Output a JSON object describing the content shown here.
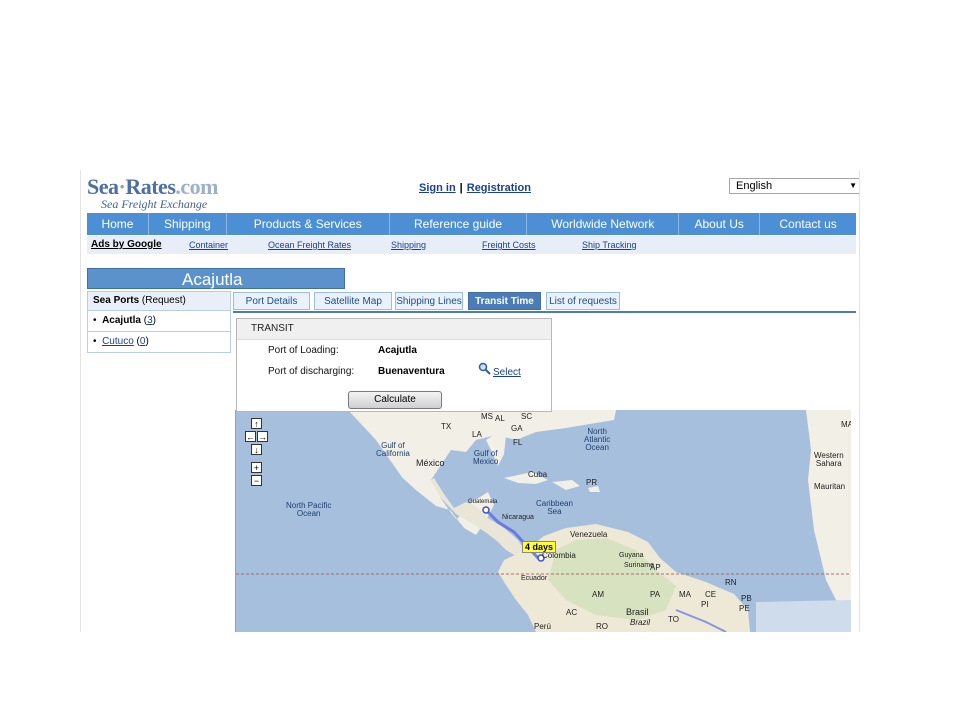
{
  "header": {
    "logo": {
      "sea": "Sea",
      "dot": "·",
      "rates": "Rates",
      "com": ".com",
      "tagline": "Sea Freight Exchange"
    },
    "sign_in": "Sign in",
    "separator": "|",
    "registration": "Registration",
    "language": "English"
  },
  "nav": {
    "items": [
      {
        "label": "Home"
      },
      {
        "label": "Shipping"
      },
      {
        "label": "Products & Services"
      },
      {
        "label": "Reference guide"
      },
      {
        "label": "Worldwide Network"
      },
      {
        "label": "About Us"
      },
      {
        "label": "Contact us"
      }
    ]
  },
  "subnav": {
    "ads": "Ads by Google",
    "links": [
      "Container",
      "Ocean Freight Rates",
      "Shipping",
      "Freight Costs",
      "Ship Tracking"
    ]
  },
  "page_title": "Acajutla",
  "sidebar": {
    "title_bold": "Sea Ports",
    "title_rest": " (Request)",
    "ports": [
      {
        "name": "Acajutla",
        "count": "3",
        "bullet": "•"
      },
      {
        "name": "Cutuco",
        "count": "0",
        "bullet": "•"
      }
    ]
  },
  "tabs": [
    {
      "label": "Port Details"
    },
    {
      "label": "Satellite Map"
    },
    {
      "label": "Shipping Lines"
    },
    {
      "label": "Transit Time"
    },
    {
      "label": "List of requests"
    }
  ],
  "transit": {
    "header": "TRANSIT",
    "loading_label": "Port of Loading:",
    "loading_value": "Acajutla",
    "discharging_label": "Port of discharging:",
    "discharging_value": "Buenaventura",
    "select_label": "Select",
    "calculate_label": "Calculate"
  },
  "map": {
    "route_label": "4 days",
    "controls": {
      "up": "↑",
      "left": "←",
      "right": "→",
      "down": "↓",
      "zoom_in": "+",
      "zoom_out": "−"
    },
    "labels": {
      "ms": "MS",
      "al": "AL",
      "ga": "GA",
      "sc": "SC",
      "tx": "TX",
      "la": "LA",
      "fl": "FL",
      "gulf_california": "Gulf of\nCalifornia",
      "mexico": "México",
      "gulf_mexico": "Gulf of\nMexico",
      "cuba": "Cuba",
      "pr": "PR",
      "north_atlantic": "North\nAtlantic\nOcean",
      "north_pacific": "North Pacific\nOcean",
      "guatemala": "Guatemala",
      "nicaragua": "Nicaragua",
      "caribbean": "Caribbean\nSea",
      "venezuela": "Venezuela",
      "colombia": "Colombia",
      "guyana": "Guyana",
      "suriname": "Suriname",
      "ap": "AP",
      "ecuador": "Ecuador",
      "am": "AM",
      "pa": "PA",
      "ma": "MA",
      "ce": "CE",
      "rn": "RN",
      "pb": "PB",
      "pe_st": "PE",
      "pi": "PI",
      "to": "TO",
      "ac": "AC",
      "ro": "RO",
      "brasil": "Brasil",
      "brazil": "Brazil",
      "peru": "Perú",
      "ma_r": "MA",
      "western_sahara": "Western\nSahara",
      "mauritan": "Mauritan"
    }
  }
}
